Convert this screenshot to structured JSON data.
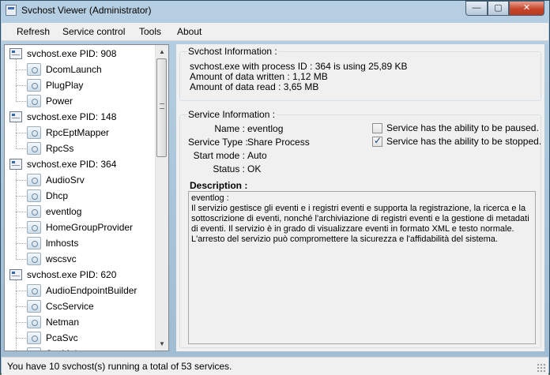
{
  "window": {
    "title": "Svchost Viewer (Administrator)",
    "controls": {
      "minimize": "—",
      "maximize": "▢",
      "close": "✕"
    }
  },
  "menu": [
    "Refresh",
    "Service control",
    "Tools",
    "About"
  ],
  "tree": [
    {
      "label": "svchost.exe PID: 908",
      "children": [
        "DcomLaunch",
        "PlugPlay",
        "Power"
      ]
    },
    {
      "label": "svchost.exe PID: 148",
      "children": [
        "RpcEptMapper",
        "RpcSs"
      ]
    },
    {
      "label": "svchost.exe PID: 364",
      "children": [
        "AudioSrv",
        "Dhcp",
        "eventlog",
        "HomeGroupProvider",
        "lmhosts",
        "wscsvc"
      ]
    },
    {
      "label": "svchost.exe PID: 620",
      "children": [
        "AudioEndpointBuilder",
        "CscService",
        "Netman",
        "PcaSvc",
        "SysMain"
      ]
    }
  ],
  "svchost_info": {
    "title": "Svchost Information :",
    "line1": "svchost.exe with process ID : 364 is using 25,89 KB",
    "line2": "Amount of data written : 1,12 MB",
    "line3": "Amount of data read : 3,65 MB"
  },
  "service_info": {
    "title": "Service Information :",
    "name_label": "Name :",
    "name_value": "eventlog",
    "type_label": "Service Type :",
    "type_value": "Share Process",
    "start_label": "Start mode :",
    "start_value": "Auto",
    "status_label": "Status :",
    "status_value": "OK",
    "pause_label": "Service has the ability to be paused.",
    "pause_checked": false,
    "stop_label": "Service has the ability to be stopped.",
    "stop_checked": true,
    "description_label": "Description :",
    "description_name": "eventlog :",
    "description_text": "Il servizio gestisce gli eventi e i registri eventi e supporta la registrazione, la ricerca e la sottoscrizione di eventi, nonché l'archiviazione di registri eventi e la gestione di metadati di eventi. Il servizio è in grado di visualizzare eventi in formato XML e testo normale. L'arresto del servizio può compromettere la sicurezza e l'affidabilità del sistema."
  },
  "status_bar": "You have 10 svchost(s) running a total of 53 services."
}
